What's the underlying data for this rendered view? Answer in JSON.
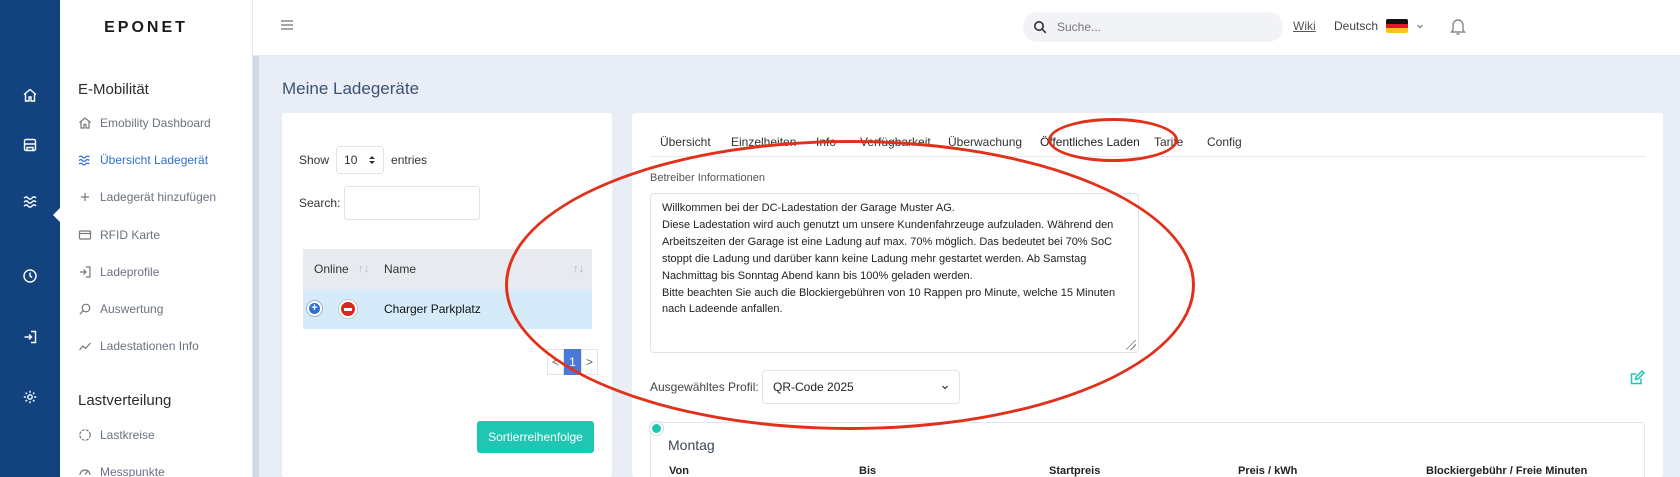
{
  "brand": "EPONET",
  "header": {
    "search_placeholder": "Suche...",
    "wiki": "Wiki",
    "language": "Deutsch"
  },
  "sidebar": {
    "section1": "E-Mobilität",
    "items": [
      {
        "label": "Emobility Dashboard",
        "icon": "home-icon"
      },
      {
        "label": "Übersicht Ladegerät",
        "icon": "waves-icon",
        "active": true
      },
      {
        "label": "Ladegerät hinzufügen",
        "icon": "plus-icon"
      },
      {
        "label": "RFID Karte",
        "icon": "card-icon"
      },
      {
        "label": "Ladeprofile",
        "icon": "login-icon"
      },
      {
        "label": "Auswertung",
        "icon": "magnifier-icon"
      },
      {
        "label": "Ladestationen Info",
        "icon": "trend-icon"
      }
    ],
    "section2": "Lastverteilung",
    "items2": [
      {
        "label": "Lastkreise",
        "icon": "circle-icon"
      },
      {
        "label": "Messpunkte",
        "icon": "gauge-icon"
      }
    ]
  },
  "page": {
    "title": "Meine Ladegeräte"
  },
  "list": {
    "show_label": "Show",
    "show_value": "10",
    "entries_label": "entries",
    "search_label": "Search:",
    "columns": [
      "Online",
      "Name"
    ],
    "rows": [
      {
        "name": "Charger Parkplatz"
      }
    ],
    "pager": {
      "prev": "<",
      "current": "1",
      "next": ">"
    },
    "sort_button": "Sortierreihenfolge"
  },
  "detail": {
    "tabs": [
      "Übersicht",
      "Einzelheiten",
      "Info",
      "Verfügbarkeit",
      "Überwachung",
      "Öffentliches Laden",
      "Tarife",
      "Config"
    ],
    "active_tab": "Öffentliches Laden",
    "operator_label": "Betreiber Informationen",
    "operator_text_lines": [
      "Willkommen bei der DC-Ladestation der Garage Muster AG.",
      "Diese Ladestation wird auch genutzt um unsere Kundenfahrzeuge aufzuladen. Während den",
      "Arbeitszeiten der Garage ist eine Ladung auf max. 70% möglich. Das bedeutet bei 70% SoC",
      "stoppt die Ladung und darüber kann keine Ladung mehr gestartet werden. Ab Samstag",
      "Nachmittag bis Sonntag Abend kann bis 100% geladen werden.",
      "Bitte beachten Sie auch die Blockiergebühren von 10 Rappen pro Minute, welche 15 Minuten",
      "nach Ladeende anfallen."
    ],
    "profile_label": "Ausgewähltes Profil:",
    "profile_value": "QR-Code 2025",
    "day": "Montag",
    "day_columns": [
      "Von",
      "Bis",
      "Startpreis",
      "Preis / kWh",
      "Blockiergebühr / Freie Minuten"
    ]
  },
  "colors": {
    "rail": "#12437e",
    "accent_teal": "#1fc7b3",
    "active_blue": "#2f6fd1",
    "annotation_red": "#e0311b",
    "row_highlight": "#d5ebfa"
  }
}
